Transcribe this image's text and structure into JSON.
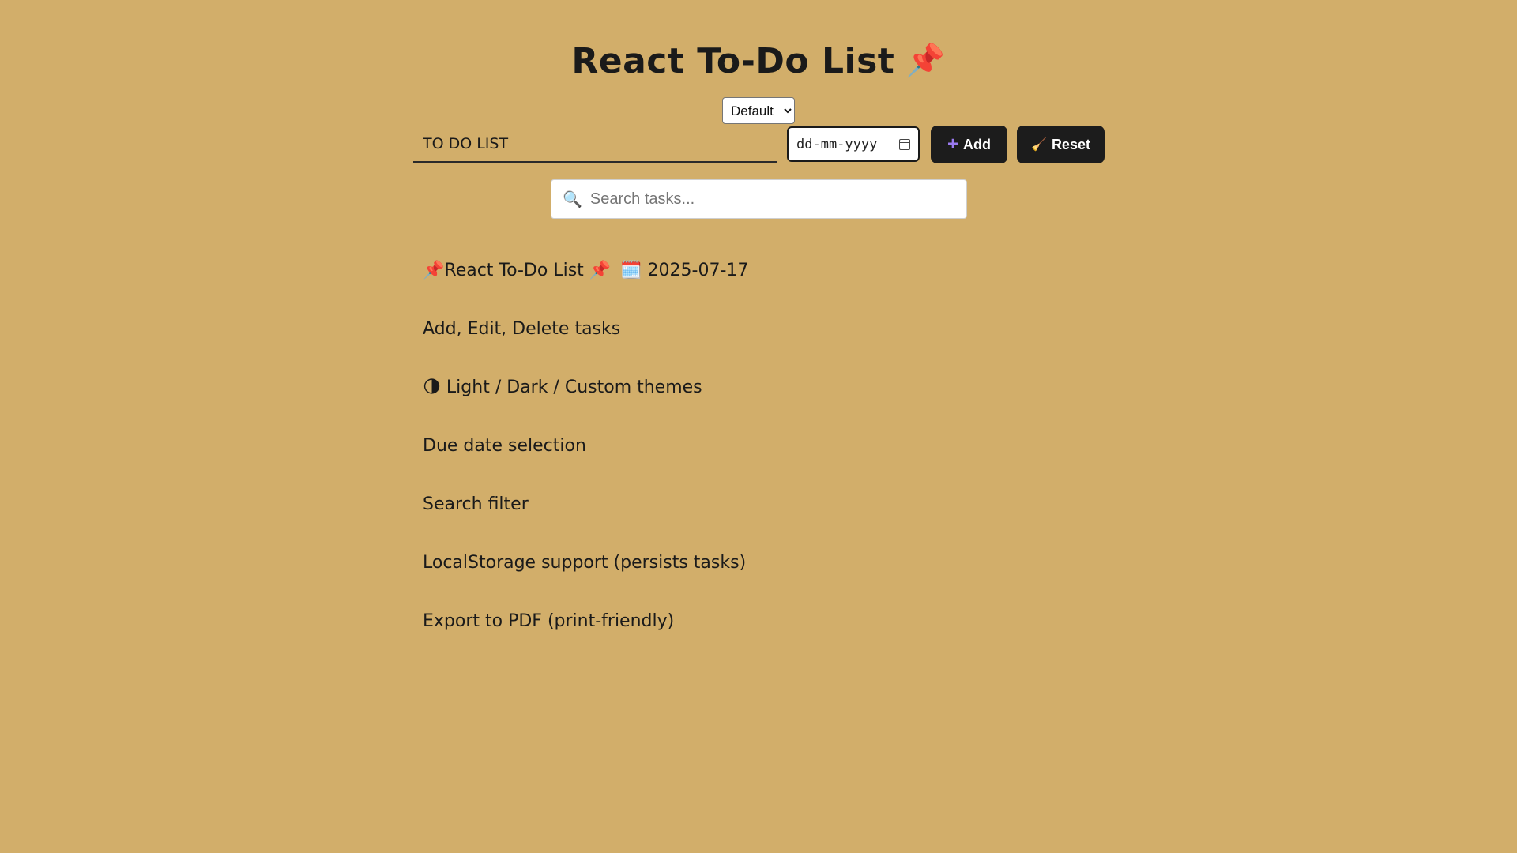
{
  "header": {
    "title": "React To-Do List",
    "title_icon": "📌"
  },
  "theme": {
    "selected": "Default"
  },
  "new_task": {
    "value": "TO DO LIST",
    "date_placeholder": "dd-mm-yyyy"
  },
  "buttons": {
    "add_label": "Add",
    "add_icon": "+",
    "reset_label": "Reset",
    "reset_icon": "🧹"
  },
  "search": {
    "placeholder": "Search tasks...",
    "icon": "🔍"
  },
  "tasks": [
    {
      "text": "📌React To-Do List 📌",
      "due": "🗓️ 2025-07-17"
    },
    {
      "text": "Add, Edit, Delete tasks",
      "due": ""
    },
    {
      "text": "🌗 Light / Dark / Custom themes",
      "due": ""
    },
    {
      "text": "Due date selection",
      "due": ""
    },
    {
      "text": "Search filter",
      "due": ""
    },
    {
      "text": "LocalStorage support (persists tasks)",
      "due": ""
    },
    {
      "text": "Export to PDF (print-friendly)",
      "due": ""
    }
  ],
  "colors": {
    "background": "#d2ae6a",
    "button_bg": "#1c1c1c",
    "accent_plus": "#9b7bf0"
  }
}
